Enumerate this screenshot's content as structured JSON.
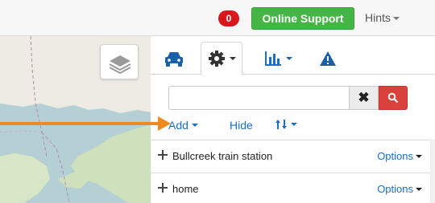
{
  "header": {
    "notification_count": "0",
    "support_label": "Online Support",
    "hints_label": "Hints"
  },
  "map": {
    "layers_icon": "layers-icon"
  },
  "tabs": [
    {
      "icon": "car-icon",
      "active": false
    },
    {
      "icon": "gear-icon",
      "active": true,
      "dropdown": true
    },
    {
      "icon": "bar-chart-icon",
      "dropdown": true
    },
    {
      "icon": "warning-icon"
    }
  ],
  "search": {
    "value": "",
    "placeholder": "",
    "clear_icon": "close-icon",
    "search_icon": "search-icon"
  },
  "toolbar": {
    "add_label": "Add",
    "hide_label": "Hide",
    "sort_icon": "sort-arrows-icon"
  },
  "items": [
    {
      "label": "Bullcreek train station",
      "options_label": "Options"
    },
    {
      "label": "home",
      "options_label": "Options"
    }
  ],
  "colors": {
    "accent_blue": "#1a6fc7",
    "support_green": "#45b545",
    "badge_red": "#d9161c",
    "search_red": "#d9423a",
    "pointer_orange": "#ee8a21"
  }
}
